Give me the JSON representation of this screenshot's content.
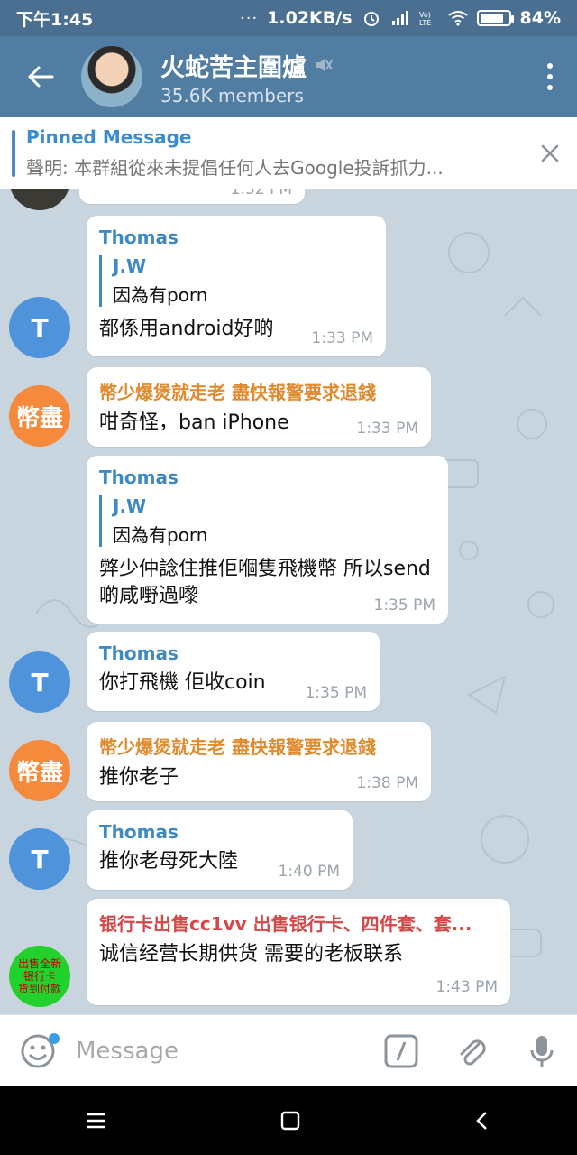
{
  "status_bar": {
    "time": "下午1:45",
    "dots": "···",
    "net_speed": "1.02KB/s",
    "battery_percent": "84%",
    "battery_level": 0.84
  },
  "header": {
    "title": "火蛇苦主圍爐",
    "members": "35.6K members"
  },
  "pinned": {
    "label": "Pinned Message",
    "text": "聲明: 本群組從來未提倡任何人去Google投訴抓力..."
  },
  "messages": [
    {
      "sender": "Thomas",
      "quote_name": "J.W",
      "quote_text": "因為有porn",
      "text": "都係用android好啲",
      "time": "1:33 PM"
    },
    {
      "sender": "幣少爆煲就走老 盡快報警要求退錢",
      "text": "咁奇怪，ban iPhone",
      "time": "1:33 PM"
    },
    {
      "sender": "Thomas",
      "quote_name": "J.W",
      "quote_text": "因為有porn",
      "text": "弊少仲諗住推佢嗰隻飛機幣 所以send啲咸嘢過嚟",
      "time": "1:35 PM"
    },
    {
      "sender": "Thomas",
      "text": "你打飛機 佢收coin",
      "time": "1:35 PM"
    },
    {
      "sender": "幣少爆煲就走老 盡快報警要求退錢",
      "text": "推你老子",
      "time": "1:38 PM"
    },
    {
      "sender": "Thomas",
      "text": "推你老母死大陸",
      "time": "1:40 PM"
    },
    {
      "sender": "银行卡出售cc1vv 出售银行卡、四件套、套...",
      "text": "诚信经营长期供货 需要的老板联系",
      "time": "1:43 PM"
    }
  ],
  "partial_top": {
    "time": "1:32 PM"
  },
  "avatars": {
    "thomas": "T",
    "bi": "幣盡",
    "bank_line1": "出售全新",
    "bank_line2": "银行卡",
    "bank_line3": "货到付款"
  },
  "input": {
    "placeholder": "Message"
  }
}
